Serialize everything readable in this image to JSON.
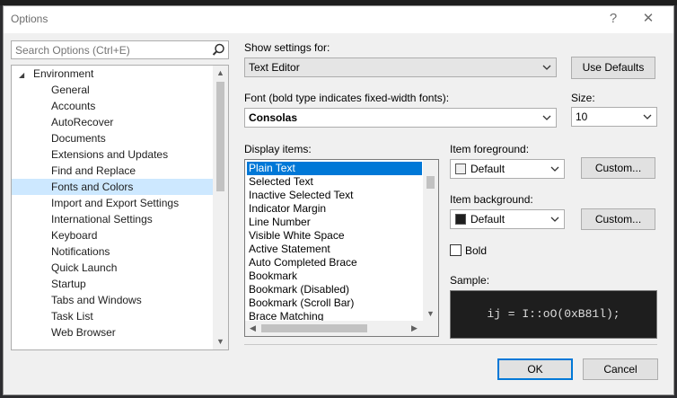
{
  "window": {
    "title": "Options",
    "help_label": "?",
    "close_label": "✕"
  },
  "search": {
    "placeholder": "Search Options (Ctrl+E)",
    "icon": "search-icon"
  },
  "tree": {
    "root": {
      "label": "Environment",
      "expanded": true
    },
    "items": [
      {
        "label": "General"
      },
      {
        "label": "Accounts"
      },
      {
        "label": "AutoRecover"
      },
      {
        "label": "Documents"
      },
      {
        "label": "Extensions and Updates"
      },
      {
        "label": "Find and Replace"
      },
      {
        "label": "Fonts and Colors",
        "selected": true
      },
      {
        "label": "Import and Export Settings"
      },
      {
        "label": "International Settings"
      },
      {
        "label": "Keyboard"
      },
      {
        "label": "Notifications"
      },
      {
        "label": "Quick Launch"
      },
      {
        "label": "Startup"
      },
      {
        "label": "Tabs and Windows"
      },
      {
        "label": "Task List"
      },
      {
        "label": "Web Browser"
      }
    ]
  },
  "settings": {
    "show_settings_label": "Show settings for:",
    "show_settings_value": "Text Editor",
    "use_defaults_label": "Use Defaults",
    "font_label": "Font (bold type indicates fixed-width fonts):",
    "font_value": "Consolas",
    "size_label": "Size:",
    "size_value": "10"
  },
  "display_items": {
    "label": "Display items:",
    "items": [
      "Plain Text",
      "Selected Text",
      "Inactive Selected Text",
      "Indicator Margin",
      "Line Number",
      "Visible White Space",
      "Active Statement",
      "Auto Completed Brace",
      "Bookmark",
      "Bookmark (Disabled)",
      "Bookmark (Scroll Bar)",
      "Brace Matching"
    ],
    "selected_index": 0
  },
  "foreground": {
    "label": "Item foreground:",
    "value": "Default",
    "swatch_color": "#f0f0f0",
    "custom_label": "Custom..."
  },
  "background": {
    "label": "Item background:",
    "value": "Default",
    "swatch_color": "#1e1e1e",
    "custom_label": "Custom..."
  },
  "bold": {
    "label": "Bold",
    "checked": false
  },
  "sample": {
    "label": "Sample:",
    "text": "ij = I::oO(0xB81l);"
  },
  "footer": {
    "ok_label": "OK",
    "cancel_label": "Cancel"
  },
  "colors": {
    "accent": "#0078d7",
    "selection_tree": "#cde8ff",
    "sample_bg": "#1e1e1e"
  }
}
